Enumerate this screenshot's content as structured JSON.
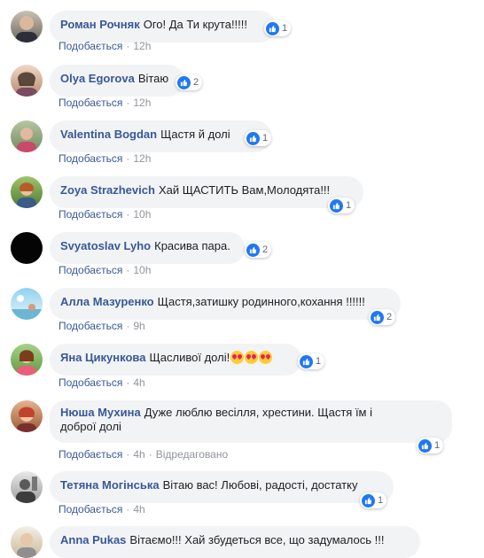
{
  "reaction_color": "#2078f4",
  "meta_labels": {
    "like": "Подобається",
    "sep": "·",
    "edited": "Відредаговано"
  },
  "comments": [
    {
      "author": "Роман Рочняк",
      "text": "Ого! Да Ти крута!!!!!",
      "likes": "1",
      "time": "12h"
    },
    {
      "author": "Olya Egorova",
      "text": "Вітаю",
      "likes": "2",
      "time": "12h"
    },
    {
      "author": "Valentina Bogdan",
      "text": "Щастя й долі",
      "likes": "1",
      "time": "12h"
    },
    {
      "author": "Zoya Strazhevich",
      "text": "Хай ЩАСТИТЬ Вам,Молодята!!!",
      "likes": "1",
      "time": "10h"
    },
    {
      "author": "Svyatoslav Lyho",
      "text": "Красива пара.",
      "likes": "2",
      "time": "10h"
    },
    {
      "author": "Алла Мазуренко",
      "text": "Щастя,затишку родинного,кохання !!!!!!",
      "likes": "2",
      "time": "9h"
    },
    {
      "author": "Яна Цикункова",
      "text": "Щасливої долі!",
      "likes": "1",
      "time": "4h",
      "emoji": "heart-eyes-emoji"
    },
    {
      "author": "Нюша Мухина",
      "text": "Дуже люблю весілля, хрестини. Щастя їм і",
      "text2": "доброї долі",
      "likes": "1",
      "time": "4h"
    },
    {
      "author": "Тетяна Могінська",
      "text": "Вітаю вас! Любові, радості, достатку",
      "likes": "1",
      "time": "4h"
    },
    {
      "author": "Anna Pukas",
      "text": "Вітаємо!!! Хай збудеться все, що задумалось !!!",
      "likes": "",
      "time": ""
    }
  ]
}
